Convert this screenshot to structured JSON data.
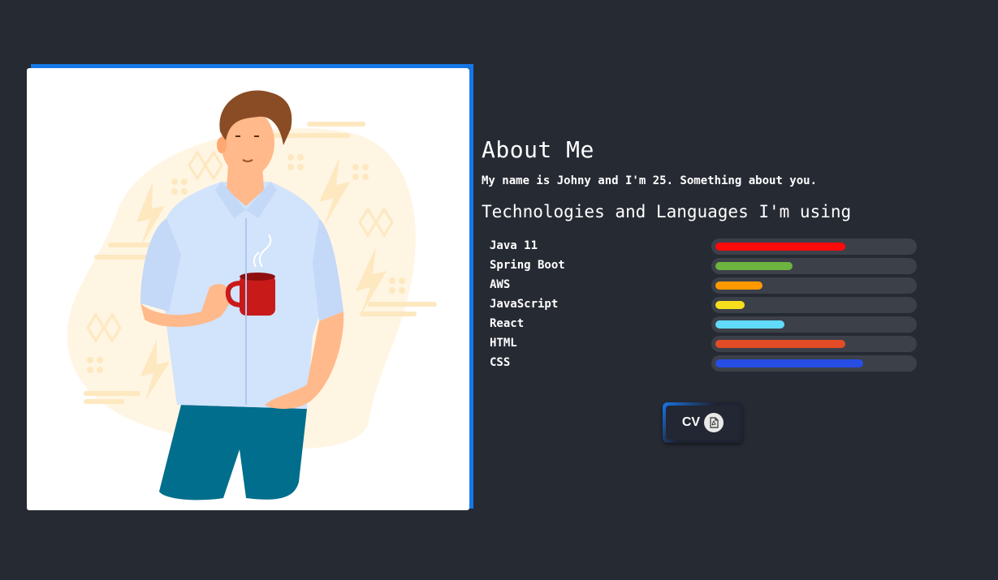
{
  "about": {
    "title": "About Me",
    "intro": "My name is Johny and I'm 25. Something about you.",
    "tech_title": "Technologies and Languages I'm using"
  },
  "skills": [
    {
      "name": "Java 11",
      "level": 0.66,
      "color": "#ff0a0a"
    },
    {
      "name": "Spring Boot",
      "level": 0.39,
      "color": "#6db33f"
    },
    {
      "name": "AWS",
      "level": 0.24,
      "color": "#ff9900"
    },
    {
      "name": "JavaScript",
      "level": 0.15,
      "color": "#f7df1e"
    },
    {
      "name": "React",
      "level": 0.35,
      "color": "#61dafb"
    },
    {
      "name": "HTML",
      "level": 0.66,
      "color": "#e34c26"
    },
    {
      "name": "CSS",
      "level": 0.75,
      "color": "#264de4"
    }
  ],
  "cv_button": {
    "label": "CV",
    "icon": "pdf-file-icon"
  },
  "colors": {
    "background": "#262a33",
    "accent": "#1577e8",
    "track": "#3c4049"
  },
  "illustration": "man-holding-coffee-mug"
}
